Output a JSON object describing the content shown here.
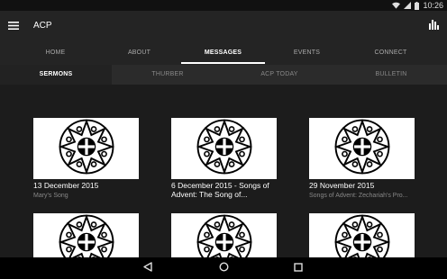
{
  "status_bar": {
    "time": "10:26"
  },
  "app_bar": {
    "title": "ACP"
  },
  "main_tabs": [
    {
      "label": "HOME"
    },
    {
      "label": "ABOUT"
    },
    {
      "label": "MESSAGES"
    },
    {
      "label": "EVENTS"
    },
    {
      "label": "CONNECT"
    }
  ],
  "active_main_tab": "MESSAGES",
  "sub_tabs": [
    {
      "label": "SERMONS"
    },
    {
      "label": "THURBER"
    },
    {
      "label": "ACP TODAY"
    },
    {
      "label": "BULLETIN"
    }
  ],
  "active_sub_tab": "SERMONS",
  "cards": [
    {
      "title": "13 December 2015",
      "subtitle": "Mary's Song"
    },
    {
      "title": "6 December 2015 - Songs of Advent: The Song of...",
      "subtitle": ""
    },
    {
      "title": "29 November 2015",
      "subtitle": "Songs of Advent: Zechariah's Pro..."
    },
    {
      "title": "",
      "subtitle": ""
    },
    {
      "title": "",
      "subtitle": ""
    },
    {
      "title": "",
      "subtitle": ""
    }
  ],
  "colors": {
    "app_bar": "#242424",
    "sub_tab_bar": "#2b2b2b",
    "content_bg": "#1c1c1c",
    "accent": "#ffffff"
  },
  "icons": {
    "menu": "hamburger-icon",
    "chart": "bar-chart-icon",
    "back": "back-icon",
    "home": "home-icon",
    "recents": "recents-icon"
  }
}
